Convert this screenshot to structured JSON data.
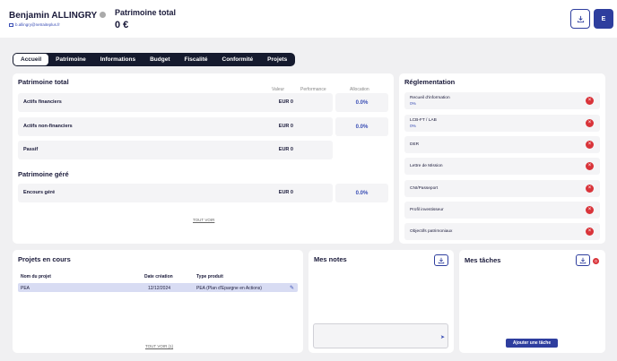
{
  "header": {
    "client_name": "Benjamin ALLINGRY",
    "client_email": "b.allingry@netraiteplus.fr",
    "total_label": "Patrimoine total",
    "total_value": "0 €",
    "profile_button_label": "E"
  },
  "tabs": [
    {
      "label": "Accueil",
      "active": true
    },
    {
      "label": "Patrimoine"
    },
    {
      "label": "Informations"
    },
    {
      "label": "Budget"
    },
    {
      "label": "Fiscalité"
    },
    {
      "label": "Conformité"
    },
    {
      "label": "Projets"
    }
  ],
  "patrimoine": {
    "title": "Patrimoine total",
    "columns": {
      "valeur": "Valeur",
      "performance": "Performance",
      "allocation": "Allocation"
    },
    "rows": [
      {
        "label": "Actifs financiers",
        "value": "EUR 0",
        "allocation": "0.0%"
      },
      {
        "label": "Actifs non-financiers",
        "value": "EUR 0",
        "allocation": "0.0%"
      },
      {
        "label": "Passif",
        "value": "EUR 0"
      }
    ],
    "gere_title": "Patrimoine géré",
    "gere_rows": [
      {
        "label": "Encours géré",
        "value": "EUR 0",
        "allocation": "0.0%"
      }
    ],
    "see_all": "TOUT VOIR"
  },
  "reglementation": {
    "title": "Réglementation",
    "items": [
      {
        "label": "Recueil d'information",
        "pct": "0%"
      },
      {
        "label": "LCB-FT / LAB",
        "pct": "0%"
      },
      {
        "label": "DER"
      },
      {
        "label": "Lettre de Mission"
      },
      {
        "label": "CNI/Passeport"
      },
      {
        "label": "Profil investisseur"
      },
      {
        "label": "Objectifs patrimoniaux"
      }
    ]
  },
  "projets": {
    "title": "Projets en cours",
    "headers": {
      "name": "Nom du projet",
      "date": "Date création",
      "type": "Type produit"
    },
    "rows": [
      {
        "name": "PEA",
        "date": "12/12/2024",
        "type": "PEA (Plan d'Epargne en Actions)"
      }
    ],
    "see_all": "TOUT VOIR (1)"
  },
  "notes": {
    "title": "Mes notes",
    "placeholder": ""
  },
  "taches": {
    "title": "Mes tâches",
    "badge": "0",
    "add_label": "Ajouter une tâche"
  },
  "colors": {
    "primary": "#2e3e9e",
    "danger": "#d9343a",
    "dark": "#151a2e",
    "highlight": "#d8dcf3"
  }
}
